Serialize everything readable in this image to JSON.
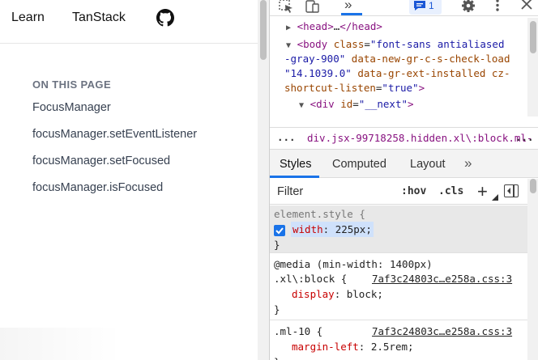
{
  "page": {
    "nav": {
      "learn": "Learn",
      "tanstack": "TanStack"
    },
    "toc": {
      "heading": "ON THIS PAGE",
      "items": [
        "FocusManager",
        "focusManager.setEventListener",
        "focusManager.setFocused",
        "focusManager.isFocused"
      ]
    }
  },
  "devtools": {
    "toolbar": {
      "more_panels": "»",
      "issues_count": "1"
    },
    "dom": {
      "head": {
        "tag_open": "<head>",
        "ellipsis": "…",
        "tag_close": "</head>"
      },
      "body": {
        "tag_open": "<body",
        "attr1_name": "class",
        "attr1_value_part1": "\"font-sans antialiased",
        "attr1_value_part2": "-gray-900\"",
        "attr2_name": "data-new-gr-c-s-check-load",
        "attr2_value": "\"14.1039.0\"",
        "attr3_name": "data-gr-ext-installed",
        "attr4_name": "cz-",
        "line4_attr": "shortcut-listen",
        "line4_value": "\"true\"",
        "tag_close": ">"
      },
      "div": {
        "tag_open": "<div",
        "attr_name": "id",
        "attr_value": "\"__next\"",
        "tag_close": ">"
      }
    },
    "breadcrumb": {
      "left": "...",
      "text": "div.jsx-99718258.hidden.xl\\:block.ml-",
      "right": "..."
    },
    "tabs": {
      "styles": "Styles",
      "computed": "Computed",
      "layout": "Layout",
      "more": "»"
    },
    "filter": {
      "placeholder": "Filter",
      "hov": ":hov",
      "cls": ".cls",
      "plus": "+"
    },
    "rules": {
      "element": {
        "selector": "element.style {",
        "prop": "width",
        "value": "225px;",
        "close": "}"
      },
      "media": {
        "query": "@media (min-width: 1400px)",
        "selector": ".xl\\:block {",
        "source": "7af3c24803c…e258a.css:3",
        "prop": "display",
        "value": "block;",
        "close": "}"
      },
      "ml": {
        "selector": ".ml-10 {",
        "source": "7af3c24803c…e258a.css:3",
        "prop": "margin-left",
        "value": "2.5rem;",
        "close": "}"
      }
    }
  }
}
